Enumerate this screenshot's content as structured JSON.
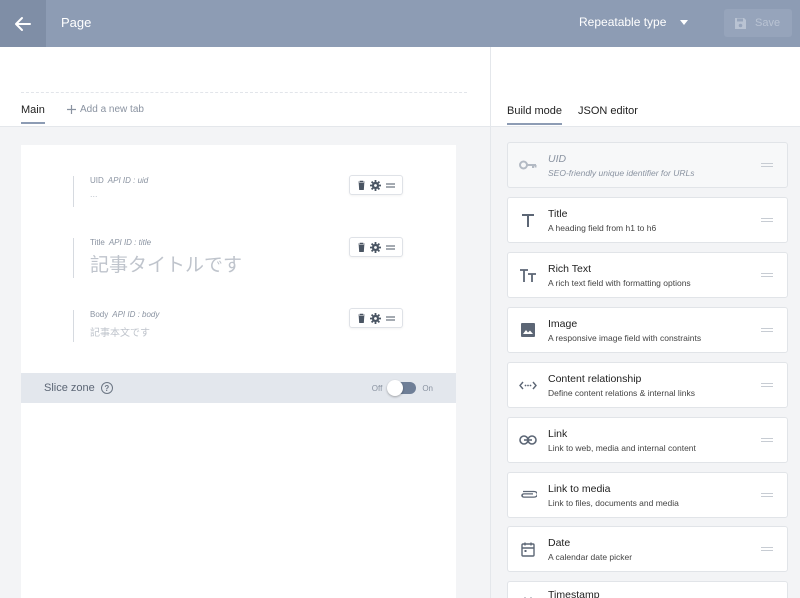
{
  "header": {
    "title": "Page",
    "type_selector": "Repeatable type",
    "save_label": "Save"
  },
  "editor": {
    "tabs": [
      {
        "label": "Main"
      },
      {
        "label": "Add a new tab"
      }
    ],
    "fields": [
      {
        "label": "UID",
        "api_id": "API ID : uid",
        "placeholder": "..."
      },
      {
        "label": "Title",
        "api_id": "API ID : title",
        "placeholder": "記事タイトルです"
      },
      {
        "label": "Body",
        "api_id": "API ID : body",
        "placeholder": "記事本文です"
      }
    ],
    "slice_zone": {
      "label": "Slice zone",
      "help": "?",
      "off_label": "Off",
      "on_label": "On",
      "enabled": false
    }
  },
  "palette": {
    "tabs": [
      {
        "label": "Build mode"
      },
      {
        "label": "JSON editor"
      }
    ],
    "items": [
      {
        "title": "UID",
        "desc": "SEO-friendly unique identifier for URLs",
        "icon": "key-icon",
        "disabled": true
      },
      {
        "title": "Title",
        "desc": "A heading field from h1 to h6",
        "icon": "title-icon"
      },
      {
        "title": "Rich Text",
        "desc": "A rich text field with formatting options",
        "icon": "rich-text-icon"
      },
      {
        "title": "Image",
        "desc": "A responsive image field with constraints",
        "icon": "image-icon"
      },
      {
        "title": "Content relationship",
        "desc": "Define content relations & internal links",
        "icon": "relationship-icon"
      },
      {
        "title": "Link",
        "desc": "Link to web, media and internal content",
        "icon": "link-icon"
      },
      {
        "title": "Link to media",
        "desc": "Link to files, documents and media",
        "icon": "paperclip-icon"
      },
      {
        "title": "Date",
        "desc": "A calendar date picker",
        "icon": "calendar-icon"
      },
      {
        "title": "Timestamp",
        "desc": "",
        "icon": "clock-icon"
      }
    ]
  },
  "colors": {
    "header_bg": "#8d9cb4",
    "accent": "#8d9cb4",
    "canvas_bg": "#f3f4f6",
    "slice_bg": "#e3e7ed"
  }
}
